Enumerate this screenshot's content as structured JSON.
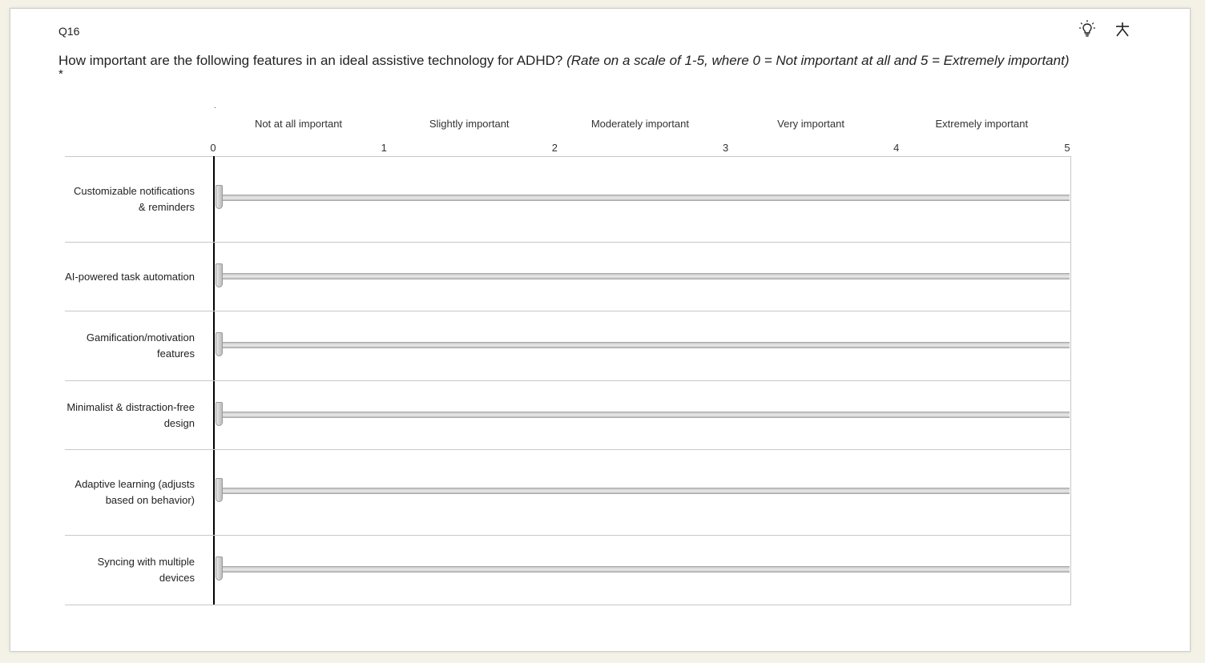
{
  "question": {
    "number": "Q16",
    "text": "How important are the following features in an ideal assistive technology for ADHD?",
    "instruction": "(Rate on a scale of 1-5, where 0 = Not important at all and 5 = Extremely important)",
    "required_mark": "*",
    "dot": "."
  },
  "icons": {
    "hint": "lightbulb-icon",
    "pin": "asterisk-icon"
  },
  "scale": {
    "labels": [
      "Not at all important",
      "Slightly important",
      "Moderately important",
      "Very important",
      "Extremely important"
    ],
    "ticks": [
      "0",
      "1",
      "2",
      "3",
      "4",
      "5"
    ]
  },
  "statements": [
    {
      "label": "Customizable notifications & reminders",
      "value": 0
    },
    {
      "label": "AI-powered task automation",
      "value": 0
    },
    {
      "label": "Gamification/motivation features",
      "value": 0
    },
    {
      "label": "Minimalist & distraction-free design",
      "value": 0
    },
    {
      "label": "Adaptive learning (adjusts based on behavior)",
      "value": 0
    },
    {
      "label": "Syncing with multiple devices",
      "value": 0
    }
  ],
  "colors": {
    "page_background": "#f4f1e6",
    "card_background": "#ffffff",
    "axis": "#000000",
    "gridline": "#c8c8c8"
  }
}
